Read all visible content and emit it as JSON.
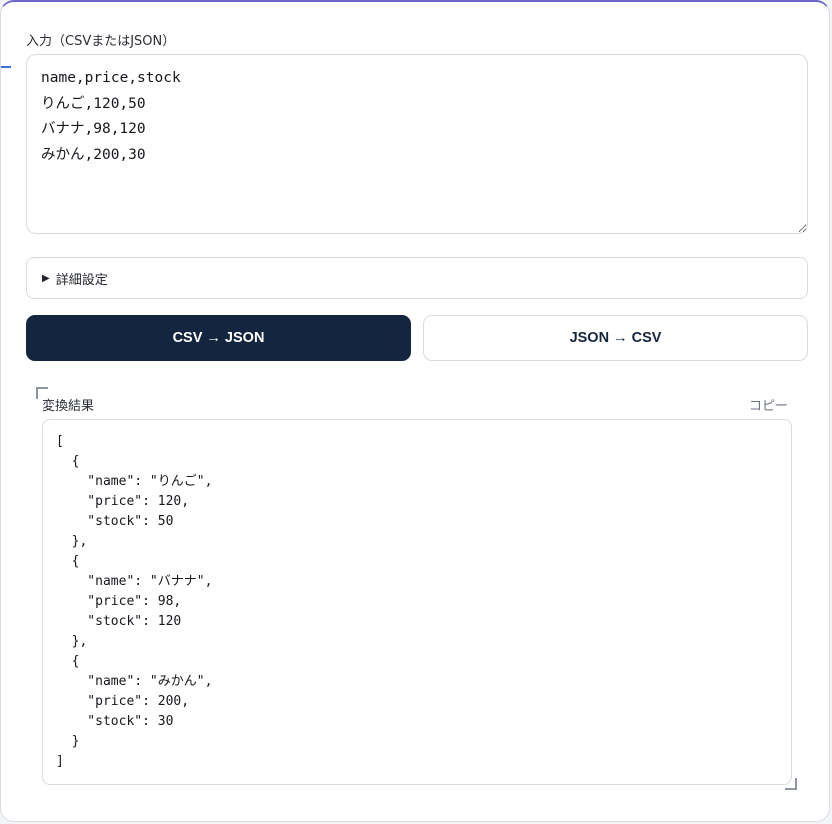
{
  "input": {
    "label": "入力（CSVまたはJSON）",
    "value": "name,price,stock\nりんご,120,50\nバナナ,98,120\nみかん,200,30"
  },
  "details": {
    "label": "詳細設定",
    "triangle": "▶"
  },
  "buttons": {
    "csv_to_json": "CSV → JSON",
    "json_to_csv": "JSON → CSV"
  },
  "result": {
    "label": "変換結果",
    "copy_label": "コピー",
    "output": "[\n  {\n    \"name\": \"りんご\",\n    \"price\": 120,\n    \"stock\": 50\n  },\n  {\n    \"name\": \"バナナ\",\n    \"price\": 98,\n    \"stock\": 120\n  },\n  {\n    \"name\": \"みかん\",\n    \"price\": 200,\n    \"stock\": 30\n  }\n]"
  },
  "colors": {
    "primary_button": "#14263f",
    "card_top_border": "#6d65c9",
    "accent": "#3b6fd8"
  }
}
